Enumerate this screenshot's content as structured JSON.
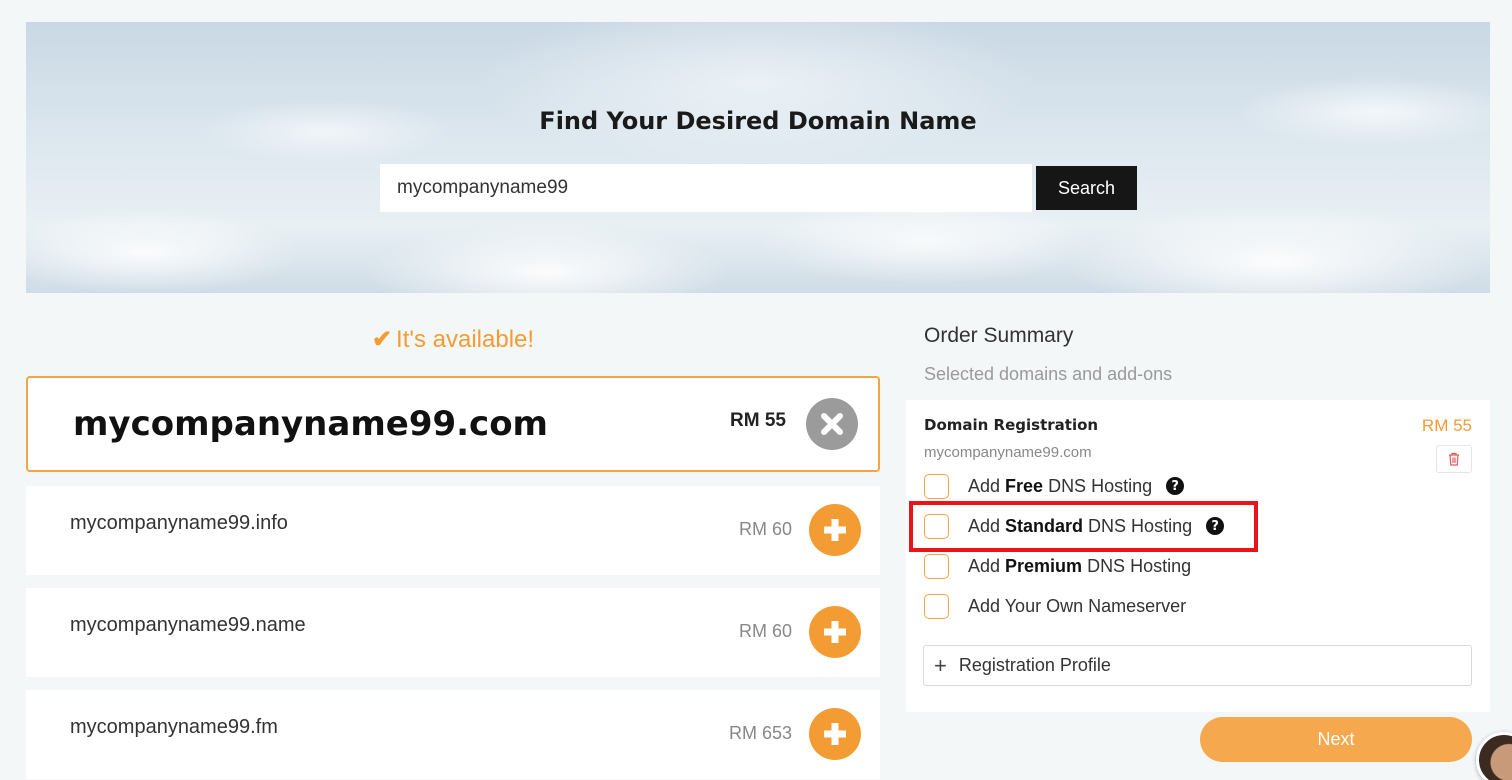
{
  "hero": {
    "title": "Find Your Desired Domain Name",
    "search_value": "mycompanyname99",
    "search_button": "Search"
  },
  "availability": {
    "icon": "check-icon",
    "text": "It's available!"
  },
  "selected_domain": {
    "name": "mycompanyname99.com",
    "price": "RM 55",
    "action_icon": "close-icon"
  },
  "suggestions": [
    {
      "name": "mycompanyname99.info",
      "price": "RM 60",
      "action_icon": "plus-icon"
    },
    {
      "name": "mycompanyname99.name",
      "price": "RM 60",
      "action_icon": "plus-icon"
    },
    {
      "name": "mycompanyname99.fm",
      "price": "RM 653",
      "action_icon": "plus-icon"
    }
  ],
  "order_summary": {
    "title": "Order Summary",
    "subtitle": "Selected domains and add-ons",
    "registration_label": "Domain Registration",
    "registration_price": "RM 55",
    "registration_domain": "mycompanyname99.com",
    "options": [
      {
        "prefix": "Add ",
        "bold": "Free",
        "suffix": " DNS Hosting",
        "help": true
      },
      {
        "prefix": "Add ",
        "bold": "Standard",
        "suffix": " DNS Hosting",
        "help": true
      },
      {
        "prefix": "Add ",
        "bold": "Premium",
        "suffix": " DNS Hosting",
        "help": false
      },
      {
        "prefix": "Add Your Own Nameserver",
        "bold": "",
        "suffix": "",
        "help": false
      }
    ],
    "registration_profile": "Registration Profile",
    "next_button": "Next"
  },
  "colors": {
    "accent": "#f39c33",
    "highlight": "#e8141a",
    "dark_button": "#161616"
  }
}
